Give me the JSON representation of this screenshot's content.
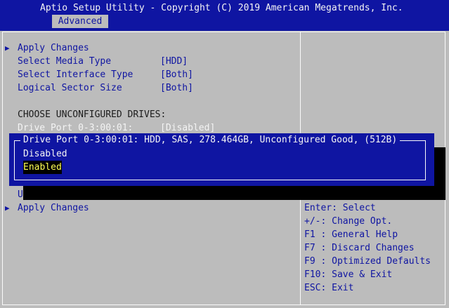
{
  "header": {
    "title": "Aptio Setup Utility - Copyright (C) 2019 American Megatrends, Inc.",
    "active_tab": "Advanced"
  },
  "main": {
    "items": [
      {
        "label": "Apply Changes",
        "value": "",
        "submenu": true
      },
      {
        "label": "Select Media Type",
        "value": "[HDD]",
        "submenu": false
      },
      {
        "label": "Select Interface Type",
        "value": "[Both]",
        "submenu": false
      },
      {
        "label": "Logical Sector Size",
        "value": "[Both]",
        "submenu": false
      }
    ],
    "section_heading": "CHOOSE UNCONFIGURED DRIVES:",
    "drive_item": {
      "label": "Drive Port 0-3:00:01:",
      "value": "[Disabled]"
    },
    "hidden_item_prefix": "U",
    "bottom_item": {
      "label": "Apply Changes",
      "submenu": true
    }
  },
  "popup": {
    "title": "Drive Port 0-3:00:01: HDD, SAS, 278.464GB, Unconfigured Good, (512B)",
    "options": [
      "Disabled",
      "Enabled"
    ],
    "selected_index": 1
  },
  "help": {
    "keys": [
      "Enter: Select",
      "+/-: Change Opt.",
      "F1 : General Help",
      "F7 : Discard Changes",
      "F9 : Optimized Defaults",
      "F10: Save & Exit",
      "ESC: Exit"
    ]
  },
  "colors": {
    "background": "#bcbcbc",
    "bar": "#0f15a2",
    "highlight": "#ffff55"
  },
  "icons": {
    "submenu_arrow": "right-triangle-icon"
  }
}
